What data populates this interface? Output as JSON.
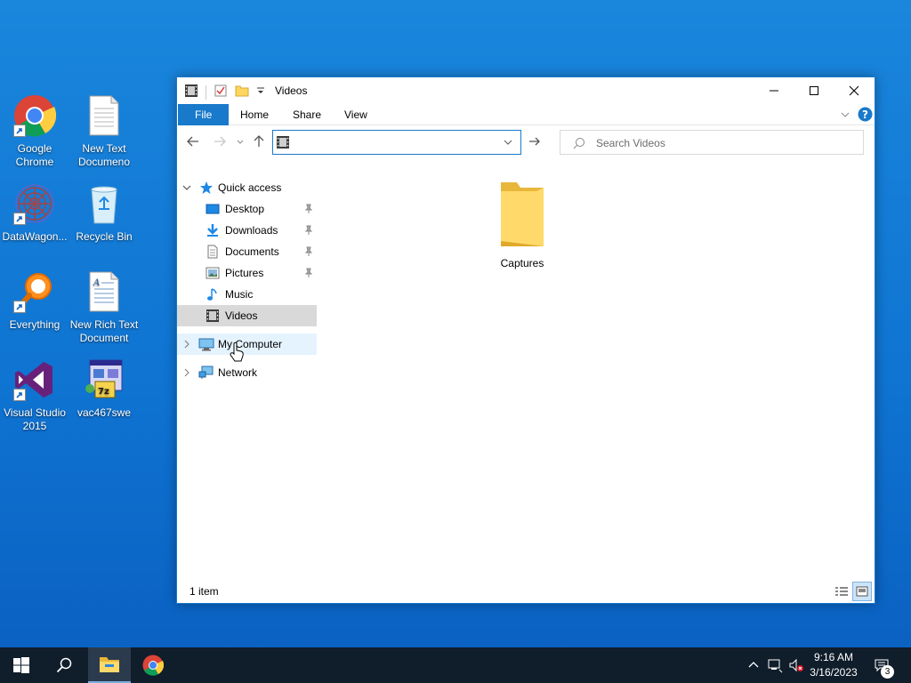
{
  "desktop": {
    "icons": [
      {
        "label": "Google Chrome",
        "icon": "chrome-icon"
      },
      {
        "label": "New Text Documeno",
        "icon": "text-document-icon"
      },
      {
        "label": "DataWagon...",
        "icon": "datawagon-icon"
      },
      {
        "label": "Recycle Bin",
        "icon": "recycle-bin-icon"
      },
      {
        "label": "Everything",
        "icon": "everything-search-icon"
      },
      {
        "label": "New Rich Text Document",
        "icon": "rich-text-document-icon"
      },
      {
        "label": "Visual Studio 2015",
        "icon": "visual-studio-icon"
      },
      {
        "label": "vac467swe",
        "icon": "installer-icon"
      }
    ]
  },
  "window": {
    "title": "Videos",
    "ribbon_tabs": [
      "File",
      "Home",
      "Share",
      "View"
    ],
    "address_value": "",
    "search_placeholder": "Search Videos",
    "nav": {
      "quick_access": "Quick access",
      "items": [
        {
          "label": "Desktop",
          "pinned": true
        },
        {
          "label": "Downloads",
          "pinned": true
        },
        {
          "label": "Documents",
          "pinned": true
        },
        {
          "label": "Pictures",
          "pinned": true
        },
        {
          "label": "Music",
          "pinned": false
        },
        {
          "label": "Videos",
          "pinned": false,
          "selected": true
        }
      ],
      "my_computer": "My Computer",
      "network": "Network"
    },
    "files": [
      {
        "name": "Captures",
        "type": "folder"
      }
    ],
    "status": "1 item",
    "accent": "#1979ca"
  },
  "taskbar": {
    "time": "9:16 AM",
    "date": "3/16/2023",
    "notifications": "3"
  }
}
